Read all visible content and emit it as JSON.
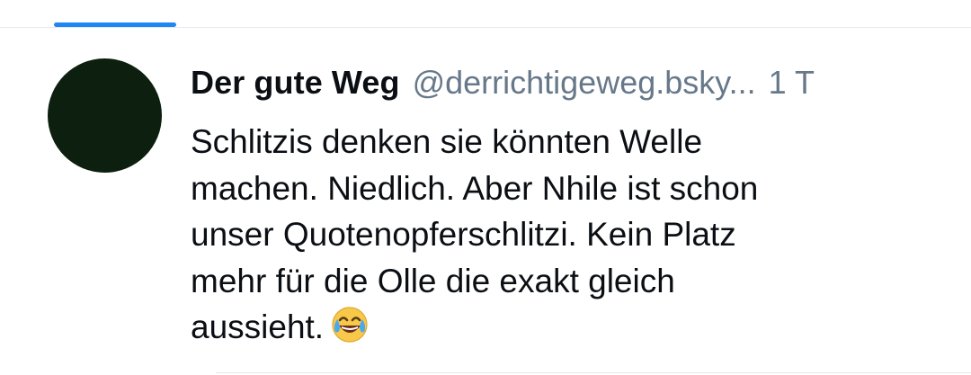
{
  "tabs": {
    "active_color": "#1f86f5"
  },
  "post": {
    "author": {
      "display_name": "Der gute Weg",
      "handle": "@derrichtigeweg.bsky...",
      "avatar_color": "#0d1f0f"
    },
    "timestamp": "1 T",
    "text": "Schlitzis denken sie könnten Welle\nmachen. Niedlich. Aber Nhile ist schon\nunser Quotenopferschlitzi. Kein Platz\nmehr für die Olle die exakt gleich\naussieht.",
    "emoji": "face-with-tears-of-joy-icon"
  }
}
